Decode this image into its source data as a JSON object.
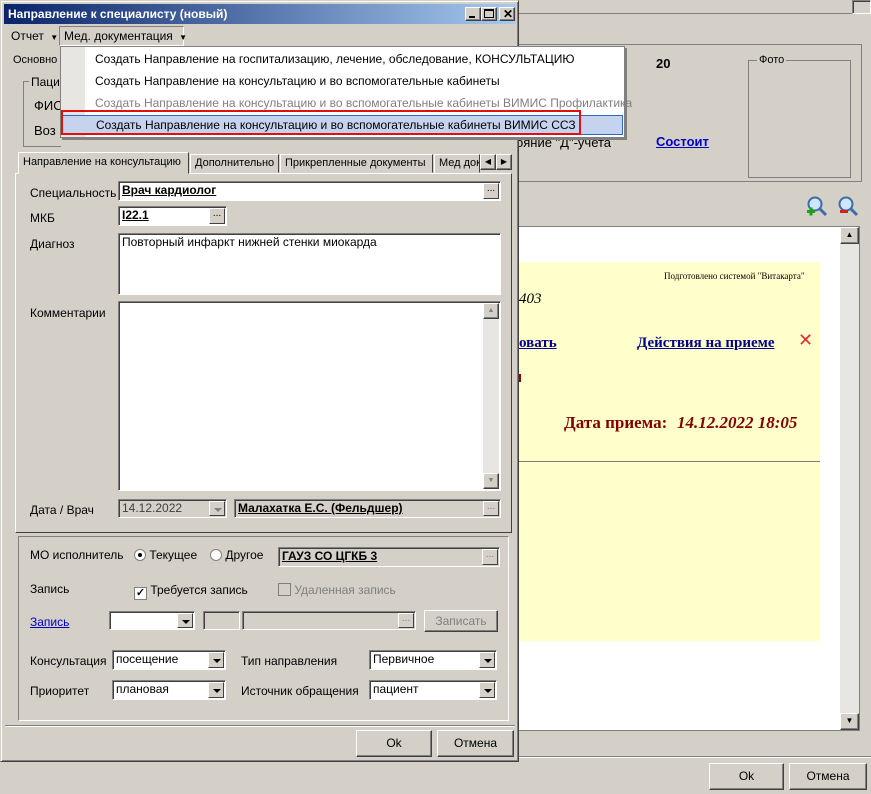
{
  "background": {
    "value_20": "20",
    "photo_label": "Фото",
    "d_account_label": "ояние \"Д\"-учета",
    "status_link": "Состоит",
    "prepared_by": "Подготовлено системой \"Витакарта\"",
    "number_fragment": "403",
    "edit_link_fragment": "овать",
    "actions_link": "Действия на приеме",
    "appointment_date_label": "Дата приема:",
    "appointment_date": "14.12.2022 18:05",
    "ok_label": "Ok",
    "cancel_label": "Отмена"
  },
  "dialog": {
    "title": "Направление к специалисту (новый)",
    "menu": {
      "report": "Отчет",
      "med_docs": "Мед. документация"
    },
    "dropdown_items": [
      "Создать Направление на госпитализацию, лечение, обследование, КОНСУЛЬТАЦИЮ",
      "Создать Направление на консультацию и во вспомогательные кабинеты",
      "Создать Направление на консультацию и во вспомогательные кабинеты ВИМИС Профилактика",
      "Создать Направление на консультацию и во вспомогательные кабинеты ВИМИС ССЗ"
    ],
    "partial_tab": "Основно",
    "group_label": "Пацие",
    "fio_label": "ФИО",
    "age_label": "Воз",
    "tabs": [
      "Направление на консультацию",
      "Дополнительно",
      "Прикрепленные документы",
      "Мед док"
    ],
    "form": {
      "specialty_label": "Специальность",
      "specialty_value": "Врач кардиолог",
      "mkb_label": "МКБ",
      "mkb_value": "I22.1",
      "diagnosis_label": "Диагноз",
      "diagnosis_value": "Повторный инфаркт нижней стенки миокарда",
      "comments_label": "Комментарии",
      "comments_value": "",
      "date_doctor_label": "Дата / Врач",
      "date_value": "14.12.2022",
      "doctor_value": "Малахатка Е.С. (Фельдшер)"
    },
    "lower": {
      "mo_label": "МО исполнитель",
      "radio_current": "Текущее",
      "radio_other": "Другое",
      "mo_value": "ГАУЗ СО ЦГКБ 3",
      "record_label": "Запись",
      "requires_record": "Требуется запись",
      "remote_record": "Удаленная запись",
      "record_link": "Запись",
      "record_button": "Записать",
      "consultation_label": "Консультация",
      "consultation_value": "посещение",
      "direction_type_label": "Тип направления",
      "direction_type_value": "Первичное",
      "priority_label": "Приоритет",
      "priority_value": "плановая",
      "source_label": "Источник обращения",
      "source_value": "пациент"
    },
    "ok_label": "Ok",
    "cancel_label": "Отмена"
  }
}
